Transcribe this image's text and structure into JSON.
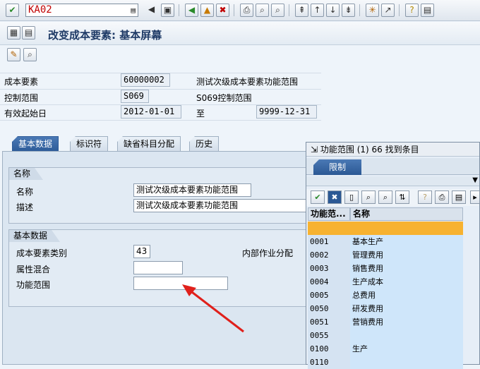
{
  "toolbar": {
    "command_value": "KA02",
    "colors": {
      "accent": "#2e5c99",
      "command_text": "#c00000",
      "arrow": "#e0201b"
    }
  },
  "title": {
    "text": "改变成本要素: 基本屏幕"
  },
  "header": {
    "cost_element_label": "成本要素",
    "cost_element_value": "60000002",
    "cost_element_desc": "测试次级成本要素功能范围",
    "controlling_area_label": "控制范围",
    "controlling_area_value": "S069",
    "controlling_area_desc": "S069控制范围",
    "valid_from_label": "有效起始日",
    "valid_from_value": "2012-01-01",
    "to_label": "至",
    "valid_to_value": "9999-12-31"
  },
  "tabs": [
    {
      "label": "基本数据",
      "active": true
    },
    {
      "label": "标识符",
      "active": false
    },
    {
      "label": "缺省科目分配",
      "active": false
    },
    {
      "label": "历史",
      "active": false
    }
  ],
  "names_group": {
    "title": "名称",
    "name_label": "名称",
    "name_value": "测试次级成本要素功能范围",
    "desc_label": "描述",
    "desc_value": "测试次级成本要素功能范围"
  },
  "basic_group": {
    "title": "基本数据",
    "cat_label": "成本要素类别",
    "cat_value": "43",
    "cat_desc": "内部作业分配",
    "attr_label": "属性混合",
    "attr_value": "",
    "func_label": "功能范围",
    "func_value": ""
  },
  "popup": {
    "title": "功能范围 (1)   66 找到条目",
    "restrict_tab": "限制",
    "col_code": "功能范...",
    "col_name": "名称",
    "rows": [
      {
        "code": "",
        "name": ""
      },
      {
        "code": "0001",
        "name": "基本生产"
      },
      {
        "code": "0002",
        "name": "管理费用"
      },
      {
        "code": "0003",
        "name": "销售费用"
      },
      {
        "code": "0004",
        "name": "生产成本"
      },
      {
        "code": "0005",
        "name": "总费用"
      },
      {
        "code": "0050",
        "name": "研发费用"
      },
      {
        "code": "0051",
        "name": "营销费用"
      },
      {
        "code": "0055",
        "name": ""
      },
      {
        "code": "0100",
        "name": "生产"
      },
      {
        "code": "0110",
        "name": ""
      }
    ]
  }
}
